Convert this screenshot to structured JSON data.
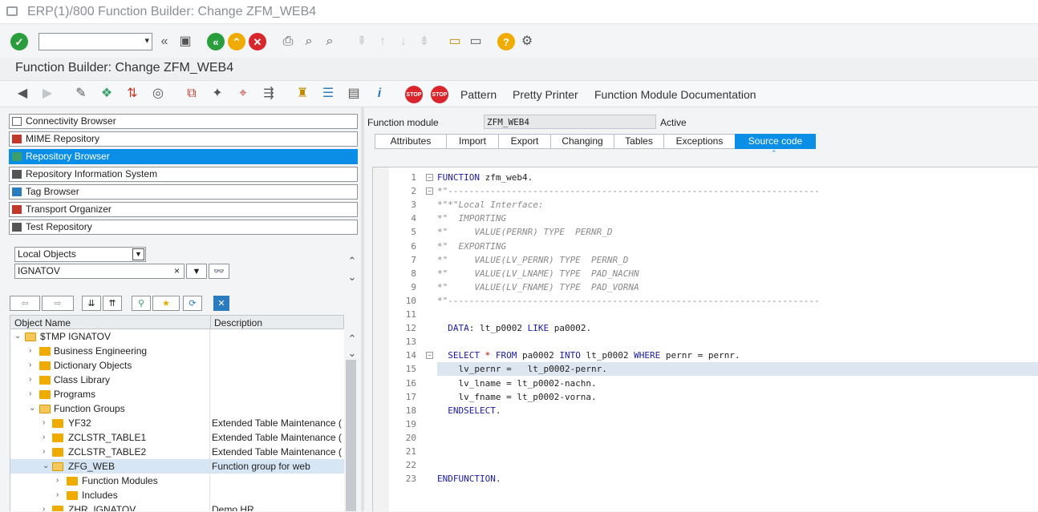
{
  "window": {
    "title": "ERP(1)/800 Function Builder: Change ZFM_WEB4"
  },
  "header": {
    "title": "Function Builder: Change ZFM_WEB4"
  },
  "app_toolbar": {
    "pattern": "Pattern",
    "pretty_printer": "Pretty Printer",
    "fm_documentation": "Function Module Documentation"
  },
  "browsers": [
    {
      "label": "Connectivity Browser"
    },
    {
      "label": "MIME Repository"
    },
    {
      "label": "Repository Browser"
    },
    {
      "label": "Repository Information System"
    },
    {
      "label": "Tag Browser"
    },
    {
      "label": "Transport Organizer"
    },
    {
      "label": "Test Repository"
    }
  ],
  "selector": {
    "object_type": "Local Objects",
    "object_name": "IGNATOV",
    "clear": "×"
  },
  "tree": {
    "col_name": "Object Name",
    "col_desc": "Description",
    "rows": [
      {
        "name": "$TMP IGNATOV",
        "desc": ""
      },
      {
        "name": "Business Engineering",
        "desc": ""
      },
      {
        "name": "Dictionary Objects",
        "desc": ""
      },
      {
        "name": "Class Library",
        "desc": ""
      },
      {
        "name": "Programs",
        "desc": ""
      },
      {
        "name": "Function Groups",
        "desc": ""
      },
      {
        "name": "YF32",
        "desc": "Extended Table Maintenance ("
      },
      {
        "name": "ZCLSTR_TABLE1",
        "desc": "Extended Table Maintenance ("
      },
      {
        "name": "ZCLSTR_TABLE2",
        "desc": "Extended Table Maintenance ("
      },
      {
        "name": "ZFG_WEB",
        "desc": "Function group for web"
      },
      {
        "name": "Function Modules",
        "desc": ""
      },
      {
        "name": "Includes",
        "desc": ""
      },
      {
        "name": "ZHR_IGNATOV",
        "desc": "Demo HR"
      }
    ]
  },
  "fm": {
    "label": "Function module",
    "value": "ZFM_WEB4",
    "status": "Active"
  },
  "tabs": [
    {
      "label": "Attributes"
    },
    {
      "label": "Import"
    },
    {
      "label": "Export"
    },
    {
      "label": "Changing"
    },
    {
      "label": "Tables"
    },
    {
      "label": "Exceptions"
    },
    {
      "label": "Source code"
    }
  ],
  "code": {
    "lines": [
      {
        "n": "1",
        "t": "FUNCTION zfm_web4."
      },
      {
        "n": "2",
        "t": "*\"----------------------------------------------------------------------"
      },
      {
        "n": "3",
        "t": "*\"*\"Local Interface:"
      },
      {
        "n": "4",
        "t": "*\"  IMPORTING"
      },
      {
        "n": "5",
        "t": "*\"     VALUE(PERNR) TYPE  PERNR_D"
      },
      {
        "n": "6",
        "t": "*\"  EXPORTING"
      },
      {
        "n": "7",
        "t": "*\"     VALUE(LV_PERNR) TYPE  PERNR_D"
      },
      {
        "n": "8",
        "t": "*\"     VALUE(LV_LNAME) TYPE  PAD_NACHN"
      },
      {
        "n": "9",
        "t": "*\"     VALUE(LV_FNAME) TYPE  PAD_VORNA"
      },
      {
        "n": "10",
        "t": "*\"----------------------------------------------------------------------"
      },
      {
        "n": "11",
        "t": ""
      },
      {
        "n": "12",
        "t": "  DATA: lt_p0002 LIKE pa0002."
      },
      {
        "n": "13",
        "t": ""
      },
      {
        "n": "14",
        "t": "  SELECT * FROM pa0002 INTO lt_p0002 WHERE pernr = pernr."
      },
      {
        "n": "15",
        "t": "    lv_pernr =   lt_p0002-pernr."
      },
      {
        "n": "16",
        "t": "    lv_lname = lt_p0002-nachn."
      },
      {
        "n": "17",
        "t": "    lv_fname = lt_p0002-vorna."
      },
      {
        "n": "18",
        "t": "  ENDSELECT."
      },
      {
        "n": "19",
        "t": ""
      },
      {
        "n": "20",
        "t": ""
      },
      {
        "n": "21",
        "t": ""
      },
      {
        "n": "22",
        "t": ""
      },
      {
        "n": "23",
        "t": "ENDFUNCTION."
      }
    ]
  }
}
